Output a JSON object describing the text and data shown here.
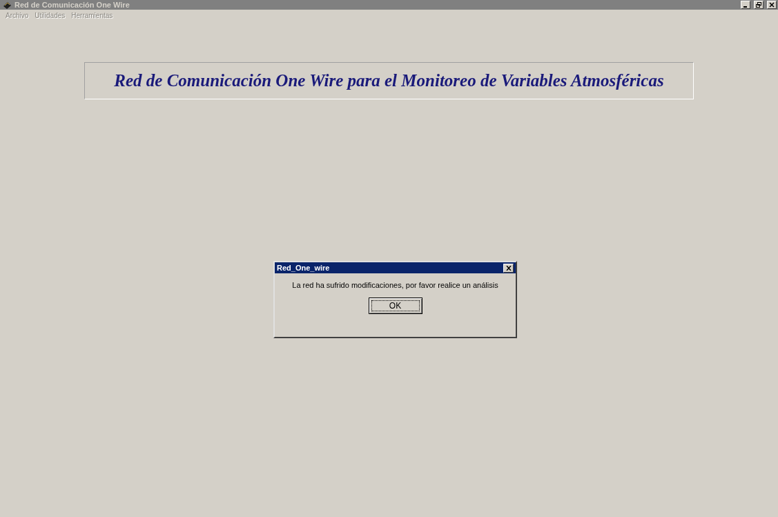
{
  "window": {
    "title": "Red de Comunicación One Wire"
  },
  "menu": [
    {
      "label": "Archivo",
      "disabled": true
    },
    {
      "label": "Utilidades",
      "disabled": true
    },
    {
      "label": "Herramientas",
      "disabled": true
    }
  ],
  "banner": {
    "text": "Red de Comunicación One Wire para el Monitoreo de Variables Atmosféricas"
  },
  "dialog": {
    "title": "Red_One_wire",
    "message": "La red ha sufrido modificaciones, por favor realice un análisis",
    "button": "OK"
  }
}
